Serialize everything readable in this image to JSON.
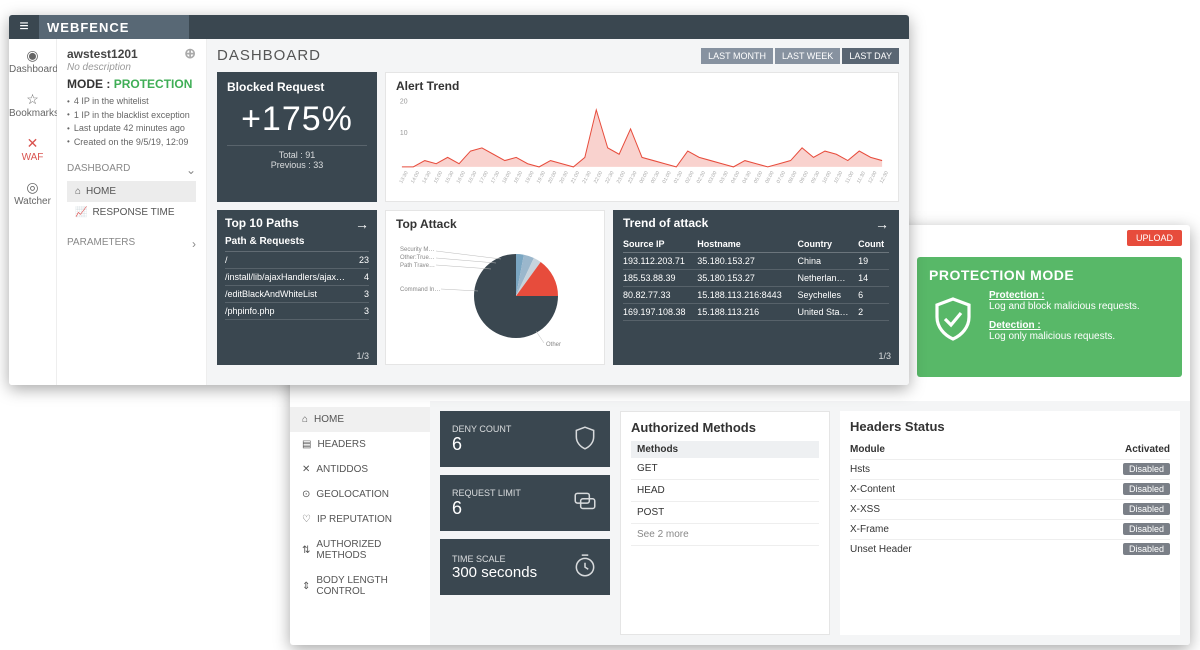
{
  "brand": "WEBFENCE",
  "iconnav": [
    {
      "label": "Dashboard",
      "icon": "◉"
    },
    {
      "label": "Bookmarks",
      "icon": "☆"
    },
    {
      "label": "WAF",
      "icon": "✕",
      "active": true
    },
    {
      "label": "Watcher",
      "icon": "◎"
    }
  ],
  "project": {
    "name": "awstest1201",
    "desc": "No description",
    "mode_label": "MODE :",
    "mode_value": "PROTECTION",
    "meta": [
      "4 IP in the whitelist",
      "1 IP in the blacklist exception",
      "Last update 42 minutes ago",
      "Created on the 9/5/19, 12:09"
    ]
  },
  "sidenav": {
    "dashboard": "DASHBOARD",
    "home": "HOME",
    "response": "RESPONSE TIME",
    "parameters": "PARAMETERS"
  },
  "page_title": "DASHBOARD",
  "range": [
    "LAST MONTH",
    "LAST WEEK",
    "LAST DAY"
  ],
  "range_selected": "LAST DAY",
  "blocked": {
    "title": "Blocked Request",
    "value": "+175%",
    "total": "Total : 91",
    "prev": "Previous : 33"
  },
  "alert_trend": {
    "title": "Alert Trend"
  },
  "top_paths": {
    "title": "Top 10 Paths",
    "header": "Path & Requests",
    "rows": [
      {
        "p": "/",
        "n": "23"
      },
      {
        "p": "/install/lib/ajaxHandlers/ajax…",
        "n": "4"
      },
      {
        "p": "/editBlackAndWhiteList",
        "n": "3"
      },
      {
        "p": "/phpinfo.php",
        "n": "3"
      }
    ],
    "pager": "1/3"
  },
  "top_attack": {
    "title": "Top Attack",
    "labels": [
      "Security M…",
      "Other:True…",
      "Path Trave…",
      "Command In…",
      "Other"
    ]
  },
  "trend_attack": {
    "title": "Trend of attack",
    "cols": [
      "Source IP",
      "Hostname",
      "Country",
      "Count"
    ],
    "rows": [
      [
        "193.112.203.71",
        "35.180.153.27",
        "China",
        "19"
      ],
      [
        "185.53.88.39",
        "35.180.153.27",
        "Netherlan…",
        "14"
      ],
      [
        "80.82.77.33",
        "15.188.113.216:8443",
        "Seychelles",
        "6"
      ],
      [
        "169.197.108.38",
        "15.188.113.216",
        "United Sta…",
        "2"
      ]
    ],
    "pager": "1/3"
  },
  "upload": "UPLOAD",
  "pmode": {
    "title": "PROTECTION MODE",
    "p1_h": "Protection :",
    "p1_t": "Log and block malicious requests.",
    "p2_h": "Detection :",
    "p2_t": "Log only malicious requests."
  },
  "w2nav": [
    "HOME",
    "HEADERS",
    "ANTIDDOS",
    "GEOLOCATION",
    "IP REPUTATION",
    "AUTHORIZED METHODS",
    "BODY LENGTH CONTROL"
  ],
  "stats": [
    {
      "label": "DENY COUNT",
      "value": "6",
      "icon": "shield"
    },
    {
      "label": "REQUEST LIMIT",
      "value": "6",
      "icon": "chat"
    },
    {
      "label": "TIME SCALE",
      "value": "300 seconds",
      "icon": "timer"
    }
  ],
  "auth_methods": {
    "title": "Authorized Methods",
    "header": "Methods",
    "rows": [
      "GET",
      "HEAD",
      "POST"
    ],
    "more": "See 2 more"
  },
  "headers_status": {
    "title": "Headers Status",
    "cols": [
      "Module",
      "Activated"
    ],
    "rows": [
      [
        "Hsts",
        "Disabled"
      ],
      [
        "X-Content",
        "Disabled"
      ],
      [
        "X-XSS",
        "Disabled"
      ],
      [
        "X-Frame",
        "Disabled"
      ],
      [
        "Unset Header",
        "Disabled"
      ]
    ]
  },
  "chart_data": [
    {
      "type": "line",
      "title": "Alert Trend",
      "ylim": [
        0,
        20
      ],
      "x": [
        "13:30",
        "14:00",
        "14:30",
        "15:00",
        "15:30",
        "16:00",
        "16:30",
        "17:00",
        "17:30",
        "18:00",
        "18:30",
        "19:00",
        "19:30",
        "20:00",
        "20:30",
        "21:00",
        "21:30",
        "22:00",
        "22:30",
        "23:00",
        "23:30",
        "00:00",
        "00:30",
        "01:00",
        "01:30",
        "02:00",
        "02:30",
        "03:00",
        "03:30",
        "04:00",
        "04:30",
        "05:00",
        "06:00",
        "07:00",
        "08:00",
        "09:00",
        "09:30",
        "10:00",
        "10:30",
        "11:00",
        "11:30",
        "12:00",
        "12:30"
      ],
      "values": [
        0,
        0,
        2,
        1,
        3,
        1,
        5,
        6,
        4,
        2,
        3,
        1,
        0,
        2,
        1,
        0,
        3,
        18,
        6,
        4,
        12,
        3,
        2,
        1,
        0,
        5,
        3,
        2,
        1,
        0,
        2,
        1,
        0,
        1,
        2,
        6,
        3,
        5,
        4,
        2,
        5,
        3,
        2
      ]
    },
    {
      "type": "pie",
      "title": "Top Attack",
      "series": [
        {
          "name": "Security Misconf.",
          "value": 3
        },
        {
          "name": "Other:True",
          "value": 4
        },
        {
          "name": "Path Traversal",
          "value": 3
        },
        {
          "name": "Command Injection",
          "value": 15
        },
        {
          "name": "Other",
          "value": 75
        }
      ]
    }
  ]
}
